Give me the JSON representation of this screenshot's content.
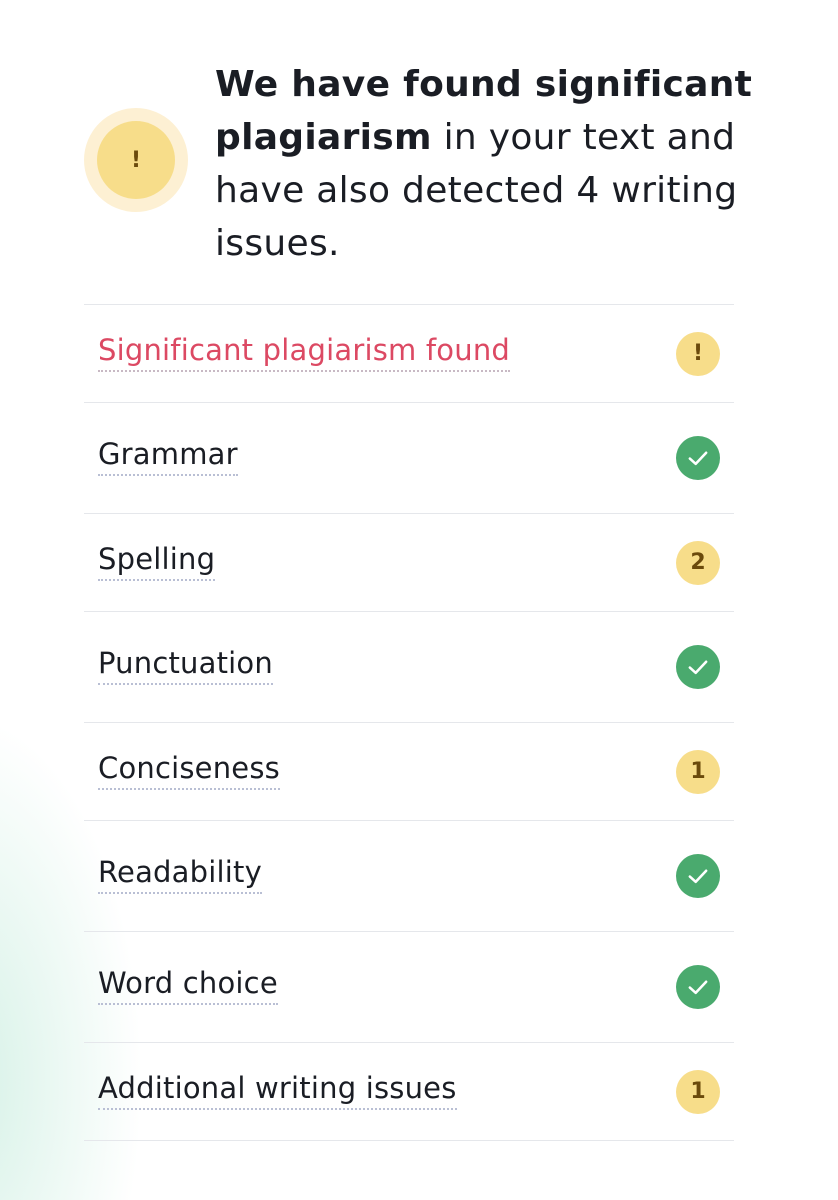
{
  "summary": {
    "icon": "warning-exclamation-icon",
    "icon_glyph": "!",
    "headline_bold": "We have found significant plagiarism",
    "headline_rest": " in your text and have also detected 4 writing issues."
  },
  "colors": {
    "alert_red": "#dc4963",
    "warning_yellow": "#f7dd8a",
    "warning_halo": "#fdf0d3",
    "success_green": "#4aaa6e"
  },
  "checks": [
    {
      "label": "Significant plagiarism found",
      "status": "warning",
      "badge": "!"
    },
    {
      "label": "Grammar",
      "status": "ok",
      "badge": "check-icon"
    },
    {
      "label": "Spelling",
      "status": "issues",
      "badge": "2"
    },
    {
      "label": "Punctuation",
      "status": "ok",
      "badge": "check-icon"
    },
    {
      "label": "Conciseness",
      "status": "issues",
      "badge": "1"
    },
    {
      "label": "Readability",
      "status": "ok",
      "badge": "check-icon"
    },
    {
      "label": "Word choice",
      "status": "ok",
      "badge": "check-icon"
    },
    {
      "label": "Additional writing issues",
      "status": "issues",
      "badge": "1"
    }
  ]
}
